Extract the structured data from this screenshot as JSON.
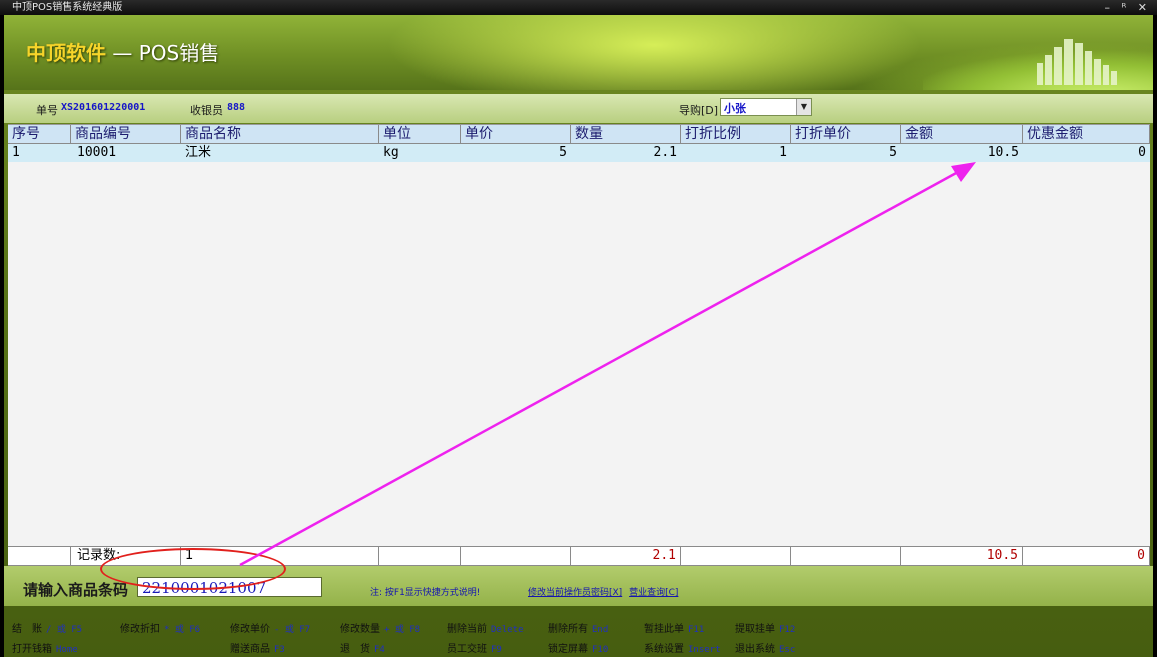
{
  "window": {
    "title": "中顶POS销售系统经典版",
    "controls": "– ᴿ ✕"
  },
  "banner": {
    "company": "中顶软件",
    "separator": " — ",
    "module": "POS销售"
  },
  "info": {
    "order_label": "单号",
    "order_no": "XS201601220001",
    "cashier_label": "收银员",
    "cashier": "888",
    "guide_label": "导购[D]",
    "guide_value": "小张"
  },
  "table": {
    "columns": [
      "序号",
      "商品编号",
      "商品名称",
      "单位",
      "单价",
      "数量",
      "打折比例",
      "打折单价",
      "金额",
      "优惠金额"
    ],
    "rows": [
      [
        "1",
        "10001",
        "江米",
        "kg",
        "5",
        "2.1",
        "1",
        "5",
        "10.5",
        "0"
      ]
    ],
    "totals": {
      "label": "记录数:",
      "count": "1",
      "qty": "2.1",
      "amount": "10.5",
      "discount": "0"
    }
  },
  "barcode": {
    "label": "请输入商品条码",
    "value": "2210001021007"
  },
  "hint": "注: 按F1显示快捷方式说明!",
  "links": [
    "修改当前操作员密码[X]",
    "营业查询[C]"
  ],
  "hotkeys": [
    {
      "label": "结　账",
      "key": "/ 或 F5"
    },
    {
      "label": "修改折扣",
      "key": "* 或 F6"
    },
    {
      "label": "修改单价",
      "key": "- 或 F7"
    },
    {
      "label": "修改数量",
      "key": "+ 或 F8"
    },
    {
      "label": "删除当前",
      "key": "Delete"
    },
    {
      "label": "删除所有",
      "key": "End"
    },
    {
      "label": "暂挂此单",
      "key": "F11"
    },
    {
      "label": "提取挂单",
      "key": "F12"
    },
    {
      "label": "打开钱箱",
      "key": "Home"
    },
    {
      "label": "赠送商品",
      "key": "F3"
    },
    {
      "label": "退　货",
      "key": "F4"
    },
    {
      "label": "员工交班",
      "key": "F9"
    },
    {
      "label": "锁定屏幕",
      "key": "F10"
    },
    {
      "label": "系统设置",
      "key": "Insert"
    },
    {
      "label": "退出系统",
      "key": "Esc"
    }
  ],
  "colors": {
    "annotation_arrow": "#ee22ee",
    "annotation_ring": "#e1201c",
    "value_blue": "#1515c8",
    "total_red": "#b00000"
  }
}
